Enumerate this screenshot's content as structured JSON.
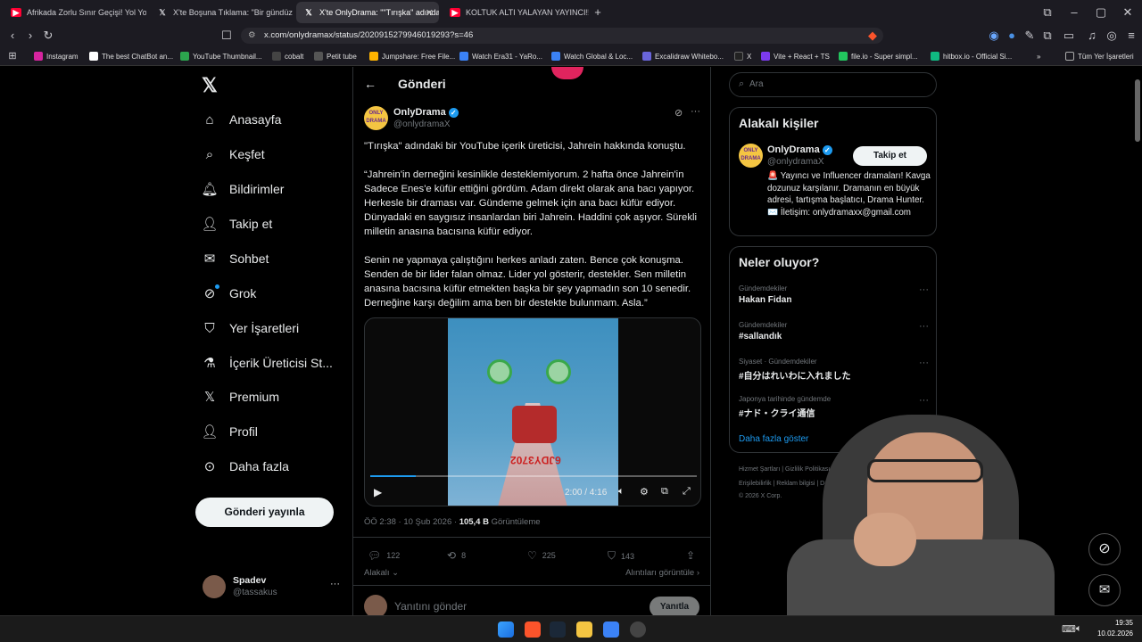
{
  "browser": {
    "tabs": [
      {
        "title": "Afrikada Zorlu Sınır Geçişi! Yol Yok R…",
        "icon": "youtube-icon"
      },
      {
        "title": "X'te Boşuna Tıklama: \"Bir gündüz kuş",
        "icon": "x-icon"
      },
      {
        "title": "X'te OnlyDrama: \"\"Tırışka\" adındaki",
        "icon": "x-icon"
      },
      {
        "title": "KOLTUK ALTI YALAYAN YAYINCI!! 😭 | E",
        "icon": "youtube-icon"
      }
    ],
    "url": "x.com/onlydramax/status/2020915279946019293?s=46",
    "bookmarks": [
      "Instagram",
      "The best ChatBot an...",
      "YouTube Thumbnail...",
      "cobalt",
      "Petit tube",
      "Jumpshare: Free File...",
      "Watch Era31 - YaRo...",
      "Watch Global & Loc...",
      "Excalidraw Whitebo...",
      "X",
      "Vite + React + TS",
      "file.io - Super simpl...",
      "hitbox.io - Official Si..."
    ],
    "all_bookmarks": "Tüm Yer İşaretleri"
  },
  "sidebar": {
    "items": [
      {
        "label": "Anasayfa",
        "icon": "home-icon"
      },
      {
        "label": "Keşfet",
        "icon": "search-icon"
      },
      {
        "label": "Bildirimler",
        "icon": "bell-icon"
      },
      {
        "label": "Takip et",
        "icon": "follow-icon"
      },
      {
        "label": "Sohbet",
        "icon": "mail-icon"
      },
      {
        "label": "Grok",
        "icon": "grok-icon"
      },
      {
        "label": "Yer İşaretleri",
        "icon": "bookmark-icon"
      },
      {
        "label": "İçerik Üreticisi St...",
        "icon": "flask-icon"
      },
      {
        "label": "Premium",
        "icon": "x-logo-icon"
      },
      {
        "label": "Profil",
        "icon": "person-icon"
      },
      {
        "label": "Daha fazla",
        "icon": "more-icon"
      }
    ],
    "post_button": "Gönderi yayınla",
    "user": {
      "name": "Spadev",
      "handle": "@tassakus"
    }
  },
  "post": {
    "header_title": "Gönderi",
    "author": {
      "name": "OnlyDrama",
      "handle": "@onlydramaX"
    },
    "intro": "\"Tırışka\" adındaki bir YouTube içerik üreticisi, Jahrein hakkında konuştu.",
    "paragraph1": "“Jahrein'in derneğini kesinlikle desteklemiyorum. 2 hafta önce Jahrein'in Sadece Enes'e küfür ettiğini gördüm. Adam direkt olarak ana bacı yapıyor. Herkesle bir draması var. Gündeme gelmek için ana bacı küfür ediyor. Dünyadaki en saygısız insanlardan biri Jahrein. Haddini çok aşıyor. Sürekli milletin anasına bacısına küfür ediyor.",
    "paragraph2": "Senin ne yapmaya çalıştığını herkes anladı zaten. Bence çok konuşma. Senden de bir lider falan olmaz. Lider yol gösterir, destekler. Sen milletin anasına bacısına küfür etmekten başka bir şey yapmadın son 10 senedir. Derneğine karşı değilim ama ben bir destekte bulunmam. Asla.”",
    "video": {
      "time": "2:00 / 4:16",
      "progress": 0.14,
      "plate_text": "6JDY3702"
    },
    "meta_time": "ÖÖ 2:38 · 10 Şub 2026 · ",
    "views": "105,4 B",
    "views_label": "Görüntüleme",
    "stats": {
      "replies": "122",
      "reposts": "8",
      "likes": "225",
      "bookmarks": "143"
    },
    "related": "Alakalı",
    "quotes": "Alıntıları görüntüle",
    "reply_placeholder": "Yanıtını gönder",
    "reply_button": "Yanıtla"
  },
  "right": {
    "search_placeholder": "Ara",
    "people_title": "Alakalı kişiler",
    "person": {
      "name": "OnlyDrama",
      "handle": "@onlydramaX",
      "follow": "Takip et",
      "bio": "🚨 Yayıncı ve Influencer dramaları! Kavga dozunuz karşılanır. Dramanın en büyük adresi, tartışma başlatıcı, Drama Hunter. ✉️ İletişim: onlydramaxx@gmail.com"
    },
    "trends_title": "Neler oluyor?",
    "trends": [
      {
        "meta": "Gündemdekiler",
        "name": "Hakan Fidan"
      },
      {
        "meta": "Gündemdekiler",
        "name": "#sallandık"
      },
      {
        "meta": "Siyaset · Gündemdekiler",
        "name": "#自分はれいわに入れました"
      },
      {
        "meta": "Japonya tarihinde gündemde",
        "name": "#ナド・クライ通信"
      }
    ],
    "show_more": "Daha fazla göster",
    "footer1": "Hizmet Şartları  |  Gizlilik Politikası  |  Çerez",
    "footer2": "Erişilebilirlik  |  Reklam bilgisi  |  Daha fazla",
    "footer3": "© 2026 X Corp."
  },
  "taskbar": {
    "time": "19:35",
    "date": "10.02.2026"
  },
  "colors": {
    "accent": "#1d9bf0",
    "verified": "#1d9bf0",
    "youtube": "#ff0000"
  }
}
